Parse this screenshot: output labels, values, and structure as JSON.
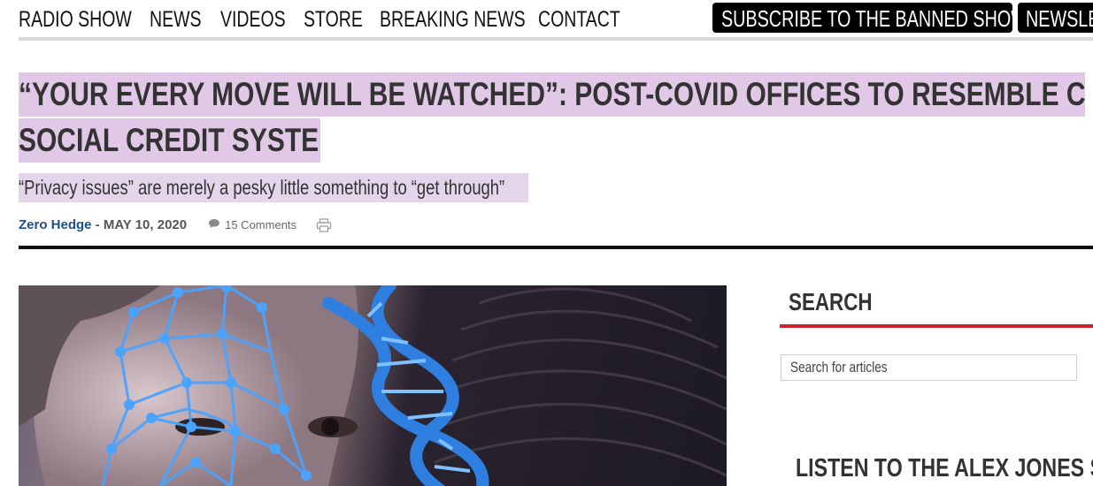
{
  "nav": {
    "items": [
      "RADIO SHOW",
      "NEWS",
      "VIDEOS",
      "STORE",
      "BREAKING NEWS",
      "CONTACT"
    ],
    "cta_subscribe": "SUBSCRIBE TO THE BANNED SHOW",
    "cta_newsletter": "NEWSLE"
  },
  "article": {
    "headline_line1": "“YOUR EVERY MOVE WILL BE WATCHED”: POST-COVID OFFICES TO RESEMBLE CHINA’S",
    "headline_line2": "SOCIAL CREDIT SYSTEM",
    "subheadline": "“Privacy issues” are merely a pesky little something to “get through”",
    "author": "Zero Hedge",
    "date_separator": " - ",
    "date": "MAY 10, 2020",
    "comments": "15 Comments",
    "hero_image_alt": "face-recognition-dna-image"
  },
  "sidebar": {
    "search_title": "SEARCH",
    "search_placeholder": "Search for articles",
    "listen_title": "LISTEN TO THE ALEX JONES SHOW"
  },
  "colors": {
    "highlight": "#e0c8e6",
    "author_link": "#1f4e8c",
    "accent_red": "#d0202a",
    "cta_bg": "#000000"
  }
}
